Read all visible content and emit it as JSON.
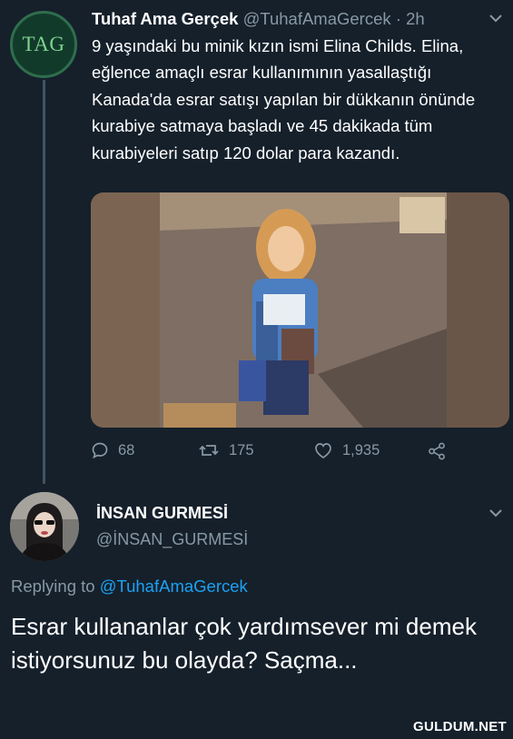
{
  "tweet": {
    "avatar_text": "TAG",
    "author_name": "Tuhaf Ama Gerçek",
    "author_handle": "@TuhafAmaGercek",
    "separator": "·",
    "time": "2h",
    "text": "9 yaşındaki bu minik kızın ismi Elina Childs. Elina, eğlence amaçlı esrar kullanımının yasallaştığı Kanada'da esrar satışı yapılan bir dükkanın önünde kurabiye satmaya başladı ve 45 dakikada tüm kurabiyeleri satıp 120 dolar para kazandı.",
    "actions": {
      "replies": "68",
      "retweets": "175",
      "likes": "1,935"
    },
    "icons": [
      "comment-icon",
      "retweet-icon",
      "heart-icon",
      "share-icon",
      "chevron-down-icon"
    ]
  },
  "reply": {
    "author_name": "İNSAN GURMESİ",
    "author_handle": "@İNSAN_GURMESİ",
    "replying_prefix": "Replying to",
    "replying_to": "@TuhafAmaGercek",
    "text": "Esrar kullananlar çok yardımsever mi demek istiyorsunuz bu olayda? Saçma..."
  },
  "watermark": "GULDUM.NET",
  "colors": {
    "background": "#15202b",
    "text": "#ffffff",
    "muted": "#8899a6",
    "link": "#1da1f2",
    "thread_line": "#425262"
  }
}
